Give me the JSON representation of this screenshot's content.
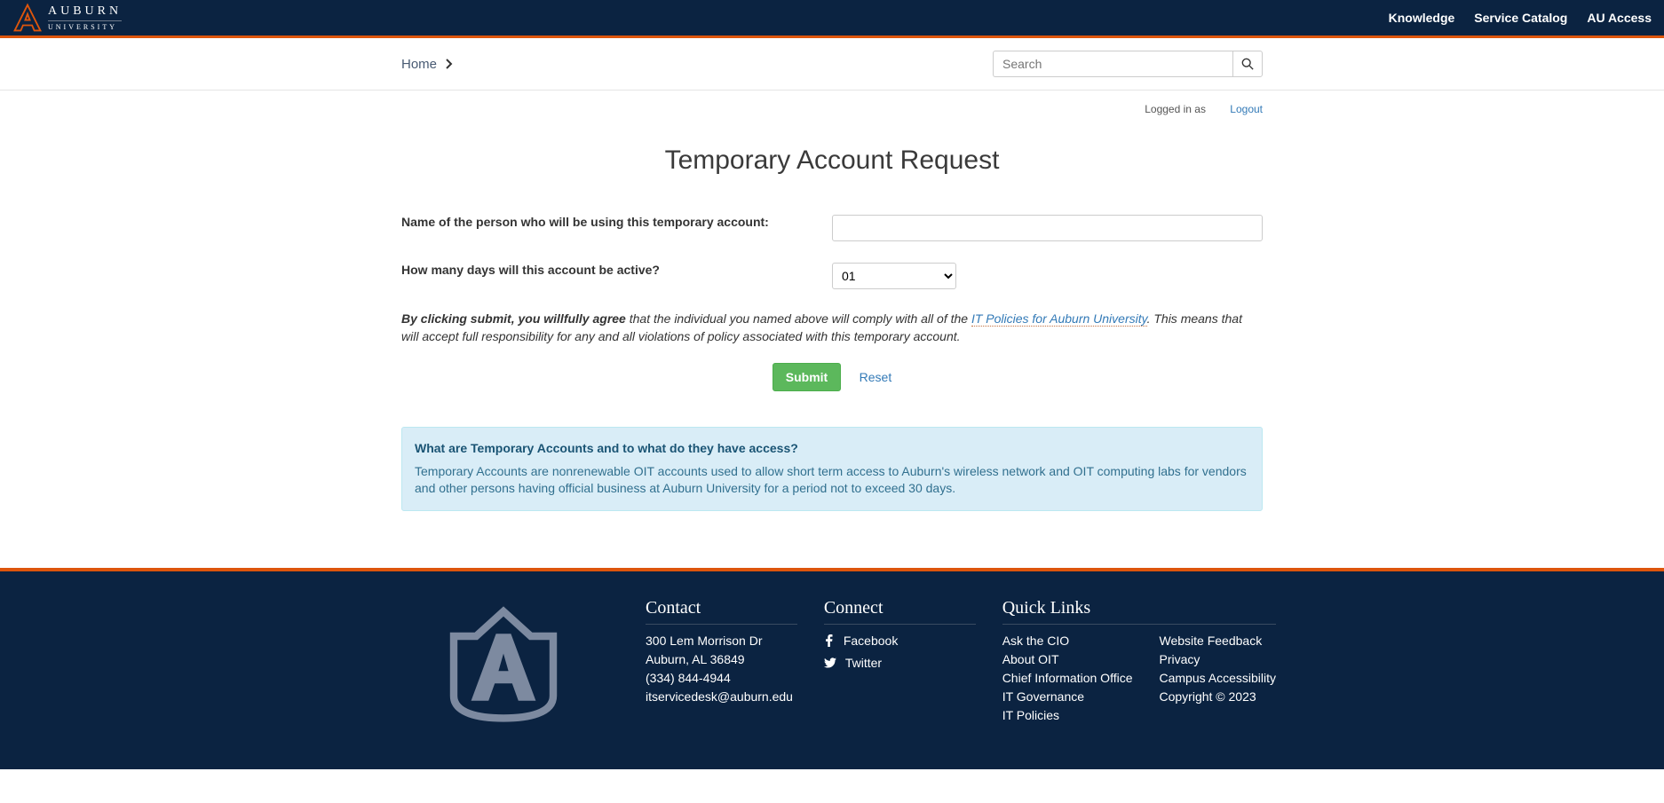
{
  "header": {
    "nav": [
      "Knowledge",
      "Service Catalog",
      "AU Access"
    ],
    "logo_main": "AUBURN",
    "logo_sub": "UNIVERSITY"
  },
  "breadcrumb": {
    "home": "Home"
  },
  "search": {
    "placeholder": "Search"
  },
  "auth": {
    "logged_in_as": "Logged in as",
    "logout": "Logout"
  },
  "page": {
    "title": "Temporary Account Request",
    "label_name": "Name of the person who will be using this temporary account:",
    "label_days": "How many days will this account be active?",
    "days_selected": "01",
    "agreement_lead": "By clicking submit, you willfully agree",
    "agreement_mid": " that the individual you named above will comply with all of the ",
    "agreement_link": "IT Policies for Auburn University",
    "agreement_after_link": ". This means that ",
    "agreement_ins": "",
    "agreement_tail": " will accept full responsibility for any and all violations of policy associated with this temporary account.",
    "submit": "Submit",
    "reset": "Reset"
  },
  "info": {
    "question": "What are Temporary Accounts and to what do they have access?",
    "answer": "Temporary Accounts are nonrenewable OIT accounts used to allow short term access to Auburn's wireless network and OIT computing labs for vendors and other persons having official business at Auburn University for a period not to exceed 30 days."
  },
  "footer": {
    "contact_h": "Contact",
    "contact_addr1": "300 Lem Morrison Dr",
    "contact_addr2": "Auburn, AL 36849",
    "contact_phone": "(334) 844-4944",
    "contact_email": "itservicedesk@auburn.edu",
    "connect_h": "Connect",
    "facebook": "Facebook",
    "twitter": "Twitter",
    "ql_h": "Quick Links",
    "ql_left": [
      "Ask the CIO",
      "About OIT",
      "Chief Information Office",
      "IT Governance",
      "IT Policies"
    ],
    "ql_right": [
      "Website Feedback",
      "Privacy",
      "Campus Accessibility",
      "Copyright © 2023"
    ]
  }
}
